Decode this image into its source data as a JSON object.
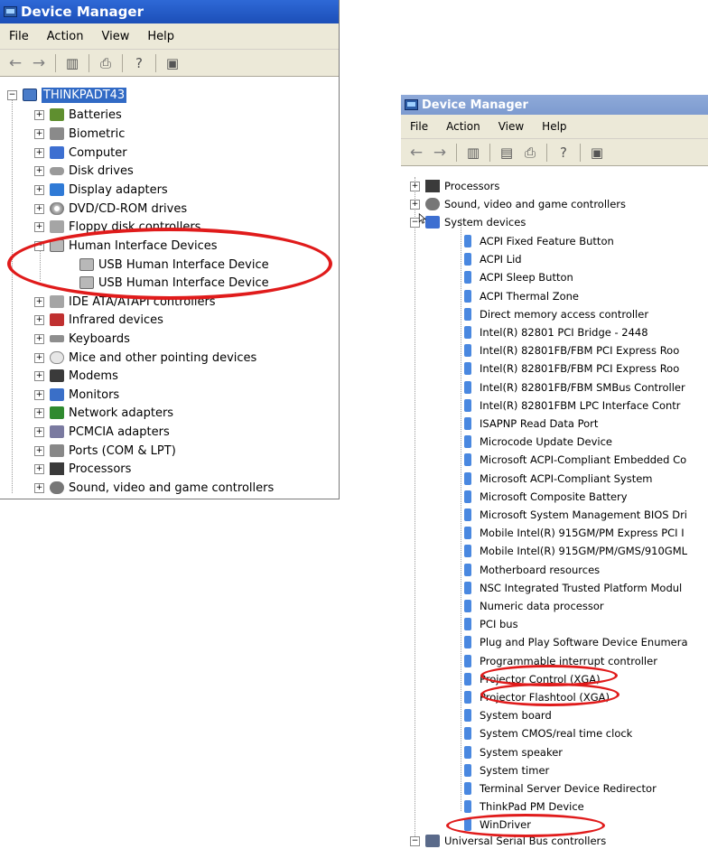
{
  "window1": {
    "title": "Device Manager",
    "menu": [
      "File",
      "Action",
      "View",
      "Help"
    ],
    "root": "THINKPADT43",
    "items": [
      "Batteries",
      "Biometric",
      "Computer",
      "Disk drives",
      "Display adapters",
      "DVD/CD-ROM drives",
      "Floppy disk controllers",
      "Human Interface Devices",
      "USB Human Interface Device",
      "USB Human Interface Device",
      "IDE ATA/ATAPI controllers",
      "Infrared devices",
      "Keyboards",
      "Mice and other pointing devices",
      "Modems",
      "Monitors",
      "Network adapters",
      "PCMCIA adapters",
      "Ports (COM & LPT)",
      "Processors",
      "Sound, video and game controllers"
    ]
  },
  "window2": {
    "title": "Device Manager",
    "menu": [
      "File",
      "Action",
      "View",
      "Help"
    ],
    "categories_top": [
      "Processors",
      "Sound, video and game controllers",
      "System devices"
    ],
    "system_devices": [
      "ACPI Fixed Feature Button",
      "ACPI Lid",
      "ACPI Sleep Button",
      "ACPI Thermal Zone",
      "Direct memory access controller",
      "Intel(R) 82801 PCI Bridge - 2448",
      "Intel(R) 82801FB/FBM PCI Express Roo",
      "Intel(R) 82801FB/FBM PCI Express Roo",
      "Intel(R) 82801FB/FBM SMBus Controller",
      "Intel(R) 82801FBM LPC Interface Contr",
      "ISAPNP Read Data Port",
      "Microcode Update Device",
      "Microsoft ACPI-Compliant Embedded Co",
      "Microsoft ACPI-Compliant System",
      "Microsoft Composite Battery",
      "Microsoft System Management BIOS Dri",
      "Mobile Intel(R) 915GM/PM Express PCI I",
      "Mobile Intel(R) 915GM/PM/GMS/910GML",
      "Motherboard resources",
      "NSC Integrated Trusted Platform Modul",
      "Numeric data processor",
      "PCI bus",
      "Plug and Play Software Device Enumera",
      "Programmable interrupt controller",
      "Projector Control  (XGA)",
      "Projector Flashtool (XGA)",
      "System board",
      "System CMOS/real time clock",
      "System speaker",
      "System timer",
      "Terminal Server Device Redirector",
      "ThinkPad PM Device",
      "WinDriver"
    ],
    "categories_bottom": [
      "Universal Serial Bus controllers"
    ]
  },
  "colors": {
    "highlight_circle": "#e01b1b",
    "selection": "#316ac5"
  }
}
